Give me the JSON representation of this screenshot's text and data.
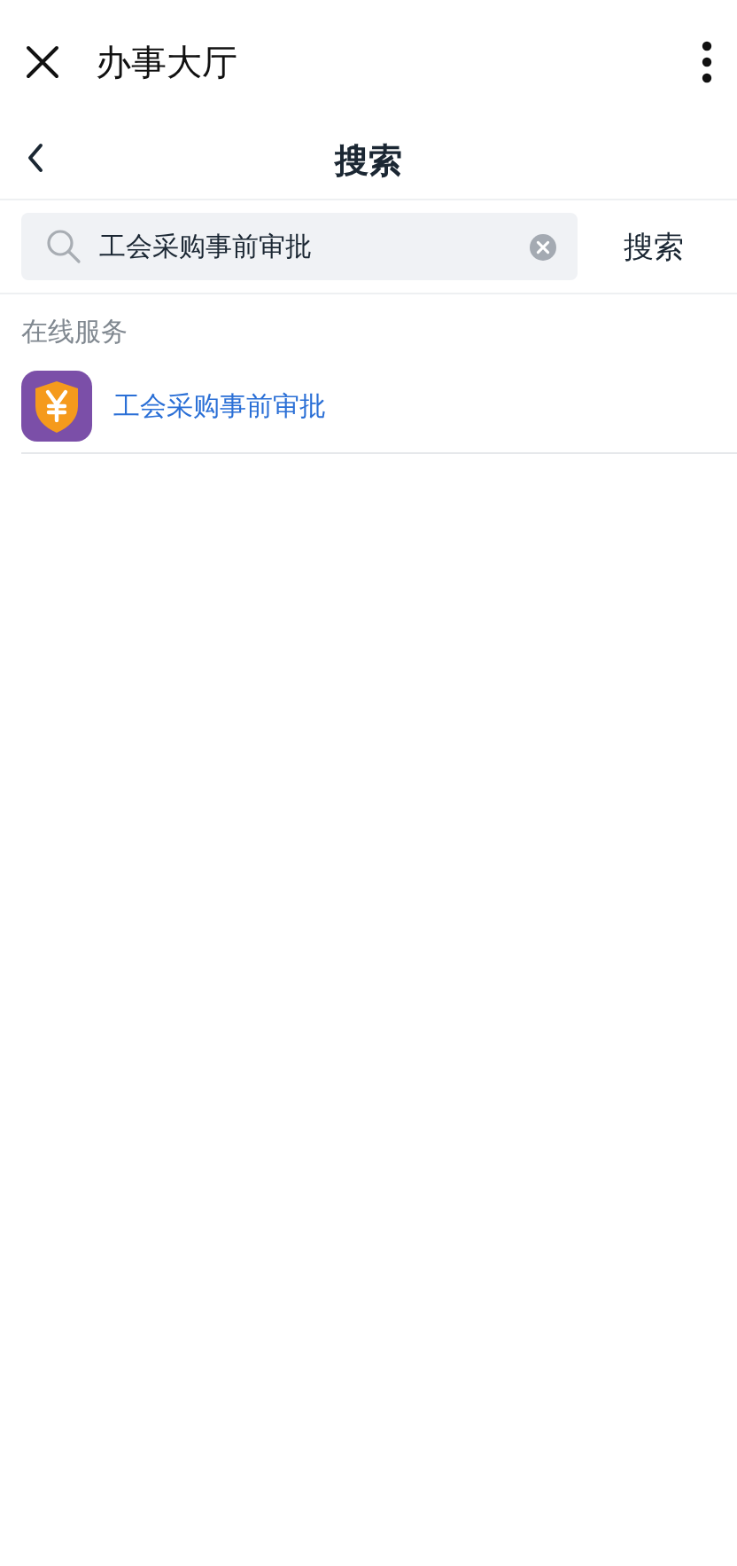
{
  "window": {
    "title": "办事大厅"
  },
  "header": {
    "title": "搜索"
  },
  "search": {
    "value": "工会采购事前审批",
    "button": "搜索"
  },
  "section": {
    "title": "在线服务"
  },
  "results": [
    {
      "label": "工会采购事前审批"
    }
  ]
}
